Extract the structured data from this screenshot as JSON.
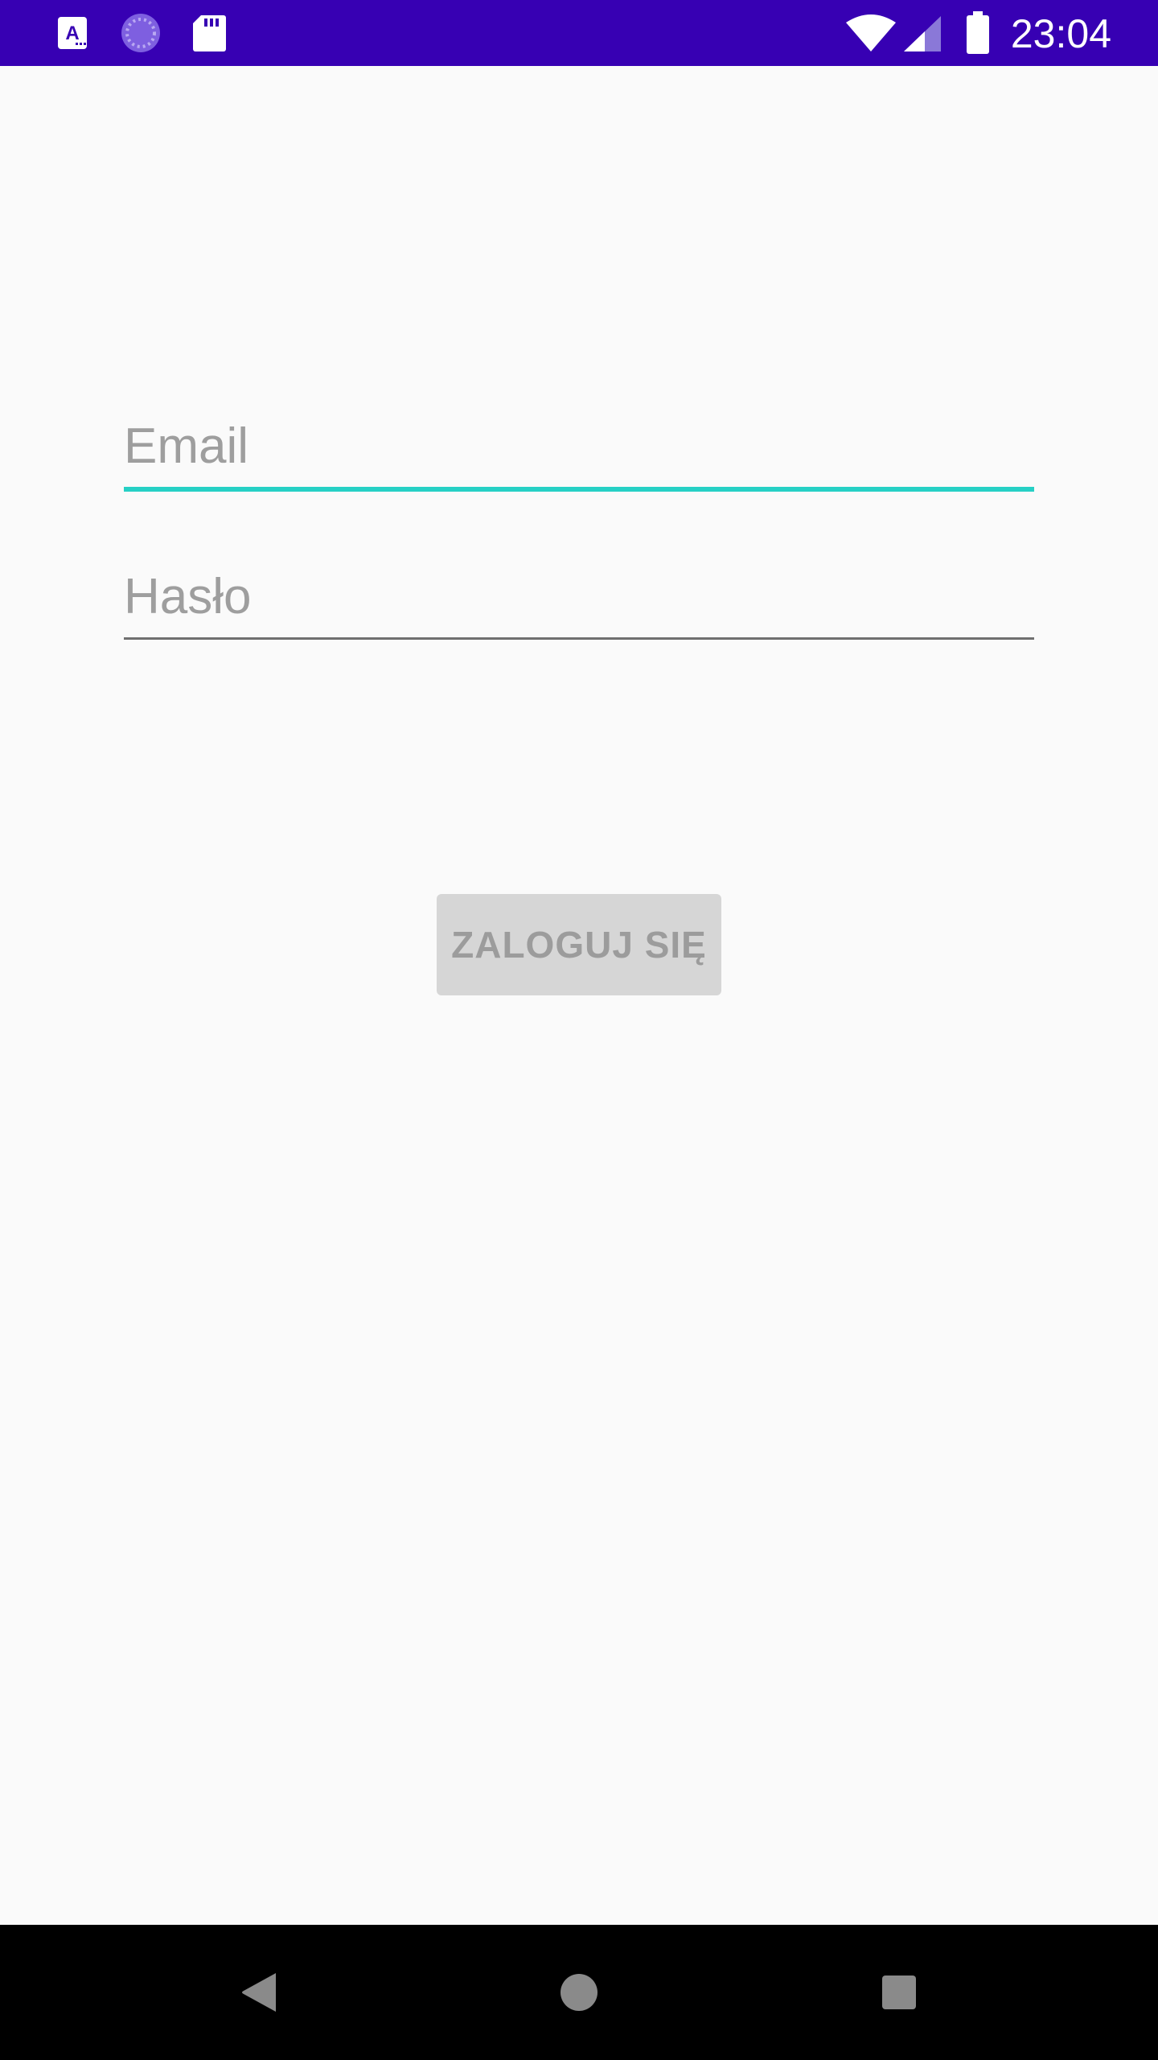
{
  "status_bar": {
    "time": "23:04",
    "background_color": "#3700b3",
    "left_icons": [
      "font-a-icon",
      "spinner-icon",
      "sd-card-icon"
    ],
    "right_icons": [
      "wifi-icon",
      "cell-signal-icon",
      "battery-icon"
    ]
  },
  "form": {
    "email": {
      "placeholder": "Email",
      "value": "",
      "focused": true,
      "accent_color": "#26d0c5"
    },
    "password": {
      "placeholder": "Hasło",
      "value": ""
    },
    "login_button": {
      "label": "ZALOGUJ SIĘ",
      "enabled": false
    }
  },
  "nav_bar": {
    "buttons": [
      "back-icon",
      "home-icon",
      "recents-icon"
    ]
  }
}
